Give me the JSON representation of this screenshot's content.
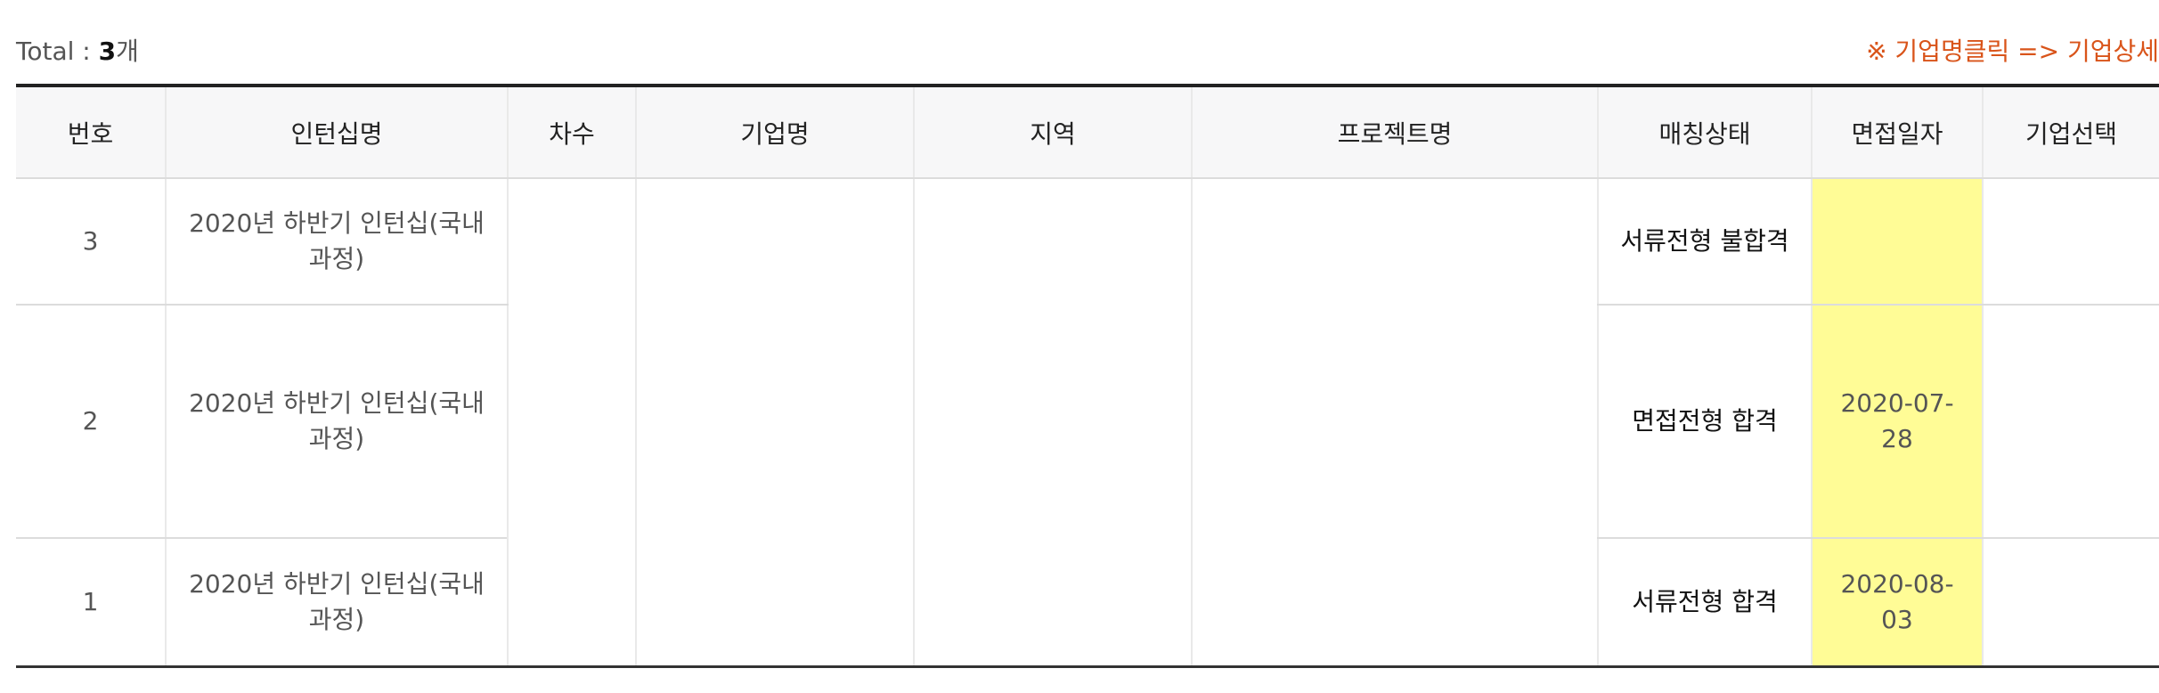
{
  "summary": {
    "total_label": "Total : ",
    "total_count": "3",
    "total_unit": "개",
    "notice": "※ 기업명클릭 => 기업상세"
  },
  "table": {
    "headers": [
      "번호",
      "인턴십명",
      "차수",
      "기업명",
      "지역",
      "프로젝트명",
      "매칭상태",
      "면접일자",
      "기업선택"
    ],
    "rows": [
      {
        "no": "3",
        "internship": "2020년 하반기 인턴십(국내과정)",
        "status": "서류전형 불합격",
        "interview_date": ""
      },
      {
        "no": "2",
        "internship": "2020년 하반기 인턴십(국내과정)",
        "status": "면접전형 합격",
        "interview_date": "2020-07-28"
      },
      {
        "no": "1",
        "internship": "2020년 하반기 인턴십(국내과정)",
        "status": "서류전형 합격",
        "interview_date": "2020-08-03"
      }
    ]
  },
  "colors": {
    "notice": "#d9541a",
    "date_highlight": "#fffc96",
    "header_bg": "#f7f7f8"
  }
}
